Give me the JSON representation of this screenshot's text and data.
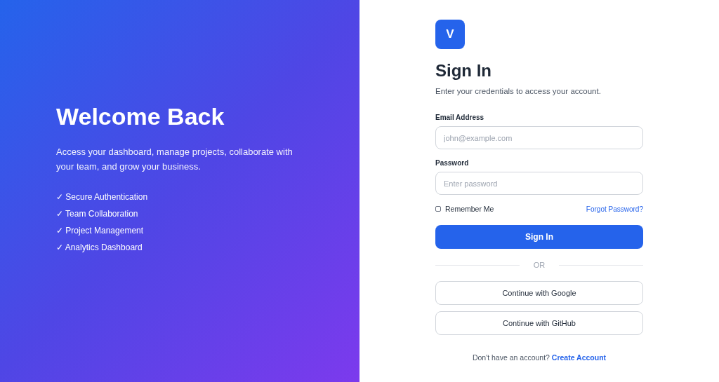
{
  "hero": {
    "title": "Welcome Back",
    "text": "Access your dashboard, manage projects, collaborate with your team, and grow your business.",
    "features": [
      "✓ Secure Authentication",
      "✓ Team Collaboration",
      "✓ Project Management",
      "✓ Analytics Dashboard"
    ]
  },
  "form": {
    "logo": "V",
    "title": "Sign In",
    "subtitle": "Enter your credentials to access your account.",
    "fields": [
      {
        "label": "Email Address",
        "placeholder": "john@example.com"
      },
      {
        "label": "Password",
        "placeholder": "Enter password"
      }
    ],
    "remember": {
      "label": "Remember Me",
      "checked": false
    },
    "forgot": "Forgot Password?",
    "submit": "Sign In",
    "divider": "OR",
    "social": [
      "Continue with Google",
      "Continue with GitHub"
    ],
    "footer": {
      "text": "Don't have an account?",
      "link": "Create Account"
    }
  }
}
